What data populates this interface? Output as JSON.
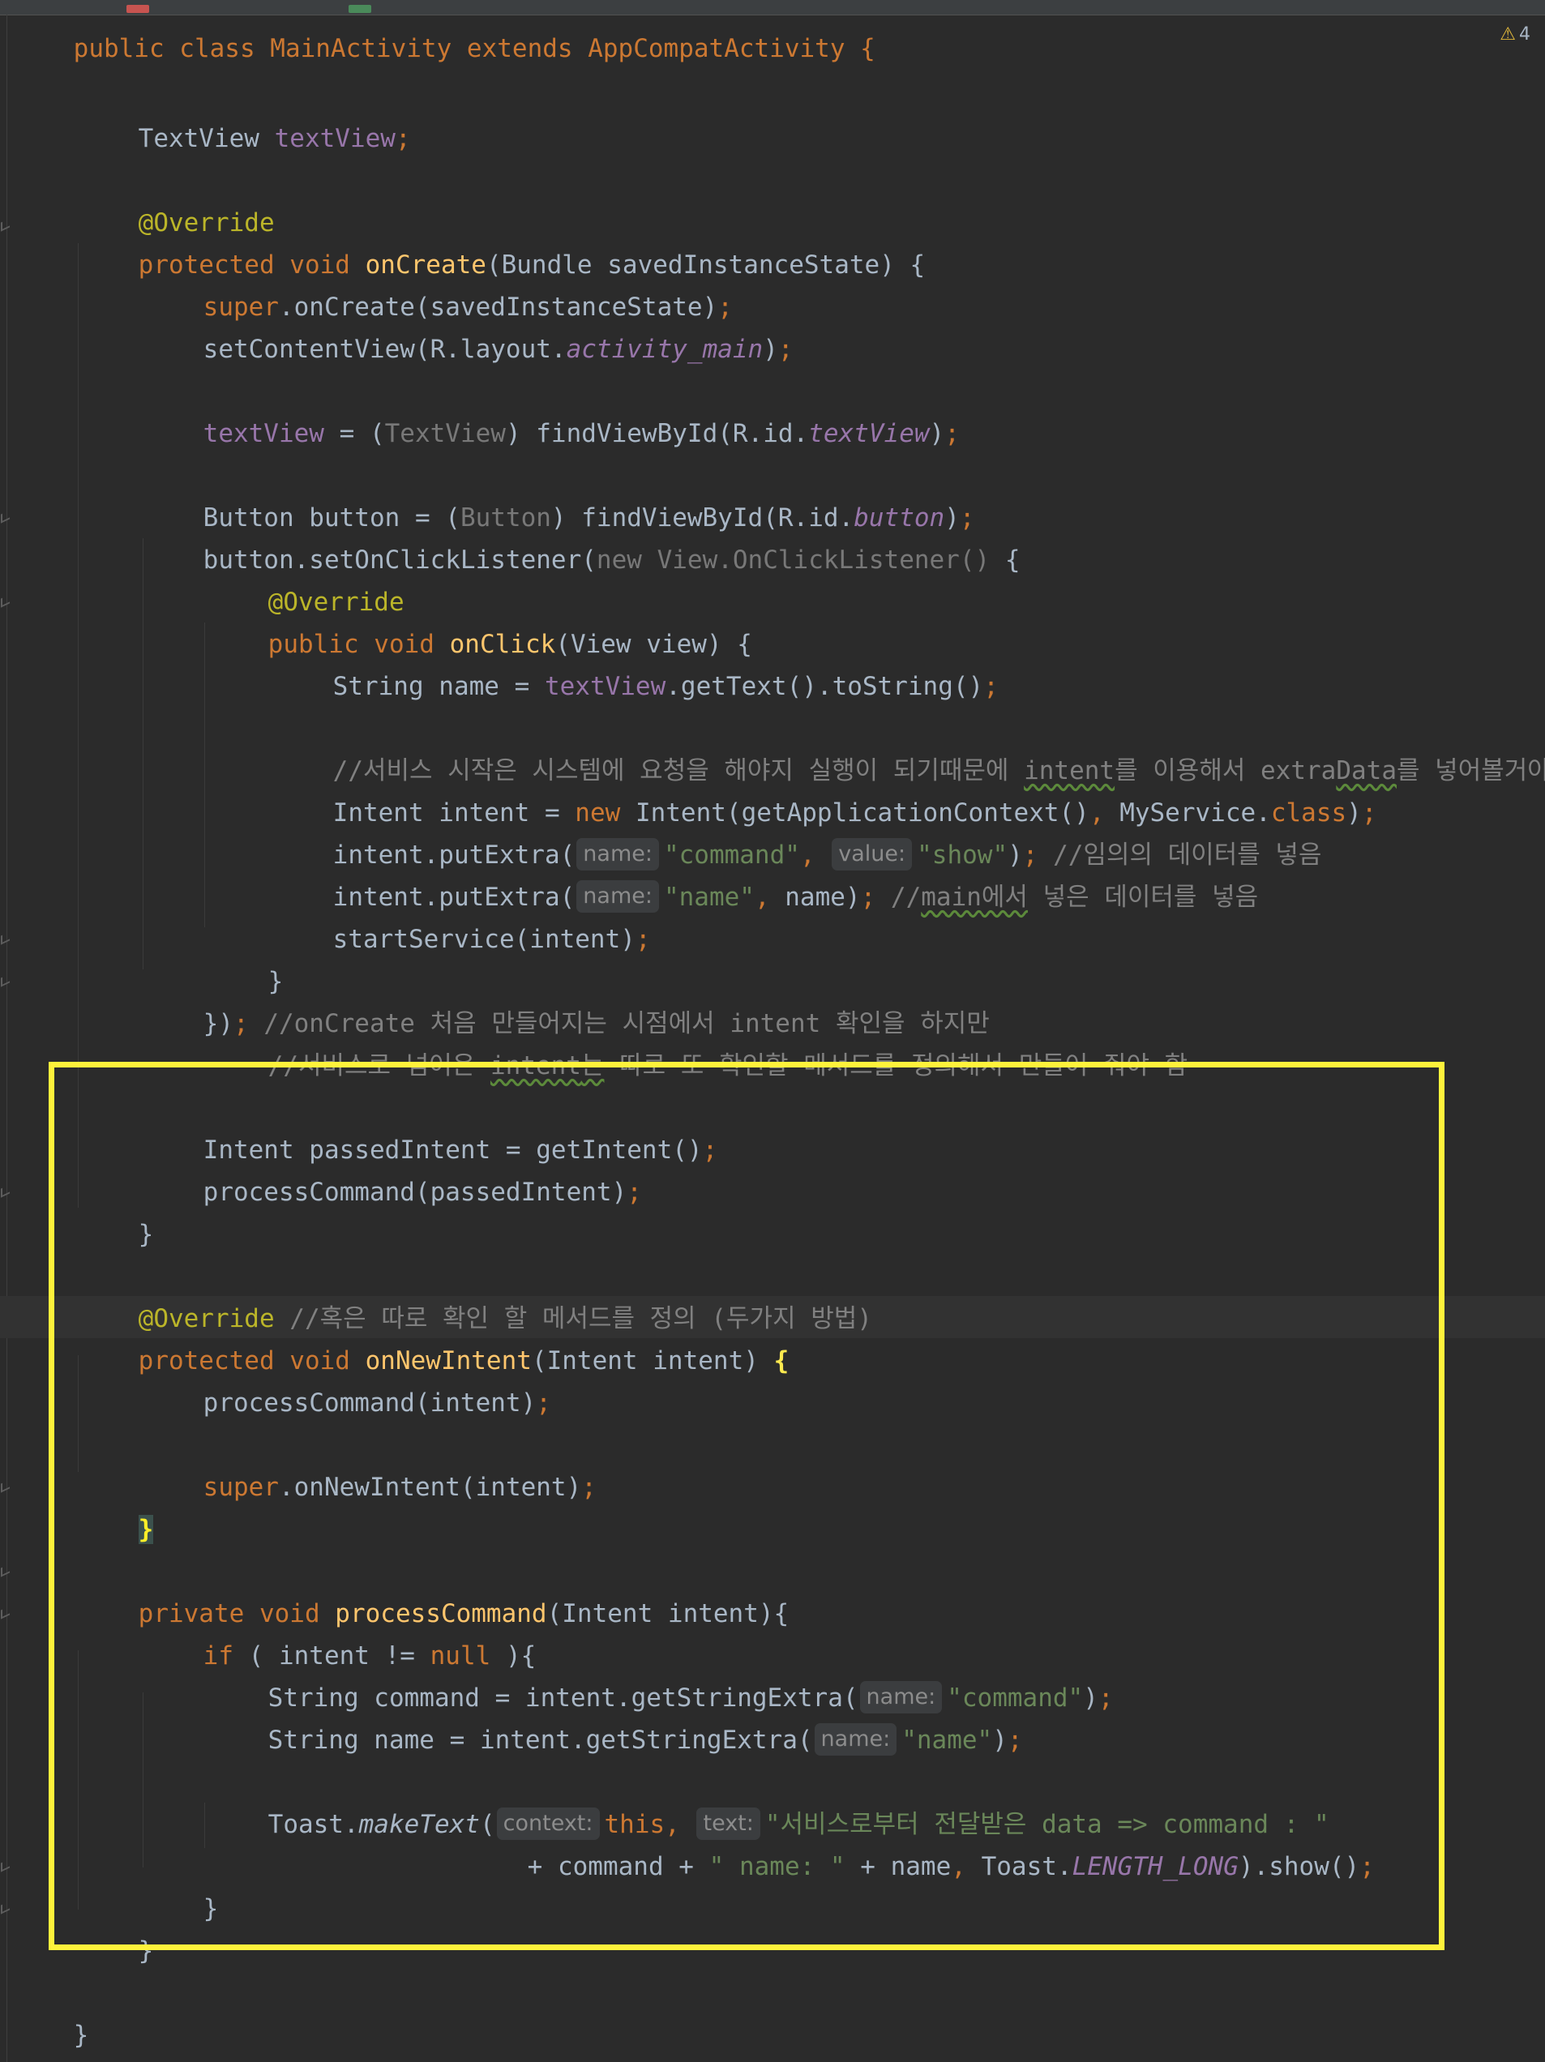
{
  "editor": {
    "warning_count": "4",
    "colors": {
      "background": "#2b2b2b",
      "keyword": "#cc7832",
      "method": "#ffc66d",
      "annotation": "#bbb529",
      "field": "#9876aa",
      "string": "#6a8759",
      "comment": "#808080",
      "highlight_box": "#fff23b"
    }
  },
  "code": {
    "l0": [
      "public class MainActivity extends AppCompatActivity {"
    ],
    "l2": [
      "TextView ",
      "textView",
      ";"
    ],
    "l4": [
      "@Override"
    ],
    "l5": [
      "protected void ",
      "onCreate",
      "(Bundle savedInstanceState) {"
    ],
    "l6": [
      "super",
      ".onCreate(savedInstanceState)",
      ";"
    ],
    "l7": [
      "setContentView(R.layout.",
      "activity_main",
      ")",
      ";"
    ],
    "l9": [
      "textView",
      " = (",
      "TextView",
      ") findViewById(R.id.",
      "textView",
      ")",
      ";"
    ],
    "l11": [
      "Button button = (",
      "Button",
      ") findViewById(R.id.",
      "button",
      ")",
      ";"
    ],
    "l12": [
      "button.setOnClickListener(",
      "new View.OnClickListener()",
      " {"
    ],
    "l13": [
      "@Override"
    ],
    "l14": [
      "public void ",
      "onClick",
      "(View view) {"
    ],
    "l15": [
      "String name = ",
      "textView",
      ".getText().toString()",
      ";"
    ],
    "l17": [
      "//서비스 시작은 시스템에 요청을 해야지 실행이 되기때문에 ",
      "intent",
      "를 이용해서 extra",
      "Data",
      "를 넣어볼거야"
    ],
    "l18": [
      "Intent intent = ",
      "new ",
      "Intent(getApplicationContext()",
      ", ",
      "MyService.",
      "class",
      ")",
      ";"
    ],
    "l19": [
      "intent.putExtra(",
      "name:",
      "\"command\"",
      ", ",
      "value:",
      "\"show\"",
      ")",
      "; ",
      "//임의의 데이터를 넣음"
    ],
    "l20": [
      "intent.putExtra(",
      "name:",
      "\"name\"",
      ", ",
      "name)",
      "; ",
      "//",
      "main",
      "에서",
      " 넣은 데이터를 넣음"
    ],
    "l21": [
      "startService(intent)",
      ";"
    ],
    "l22": [
      "}"
    ],
    "l23": [
      "})",
      "; ",
      "//onCreate 처음 만들어지는 시점에서 intent 확인을 하지만"
    ],
    "l24": [
      "//서비스로 넘어온 ",
      "intent",
      "는",
      " 따로 또 확인할 메서드를 정의해서 만들어 줘야 함"
    ],
    "l26": [
      "Intent passedIntent = getIntent()",
      ";"
    ],
    "l27": [
      "processCommand(passedIntent)",
      ";"
    ],
    "l28": [
      "}"
    ],
    "l30": [
      "@Override ",
      "//혹은 따로 확인 할 메서드를 정의 (두가지 방법)"
    ],
    "l31": [
      "protected void ",
      "onNewIntent",
      "(Intent intent) ",
      "{"
    ],
    "l32": [
      "processCommand(intent)",
      ";"
    ],
    "l34": [
      "super",
      ".onNewIntent(intent)",
      ";"
    ],
    "l35": [
      "}"
    ],
    "l37": [
      "private void ",
      "processCommand",
      "(Intent intent){"
    ],
    "l38": [
      "if ",
      "( intent != ",
      "null ",
      "){"
    ],
    "l39": [
      "String command = intent.getStringExtra(",
      "name:",
      "\"command\"",
      ")",
      ";"
    ],
    "l40": [
      "String name = intent.getStringExtra(",
      "name:",
      "\"name\"",
      ")",
      ";"
    ],
    "l42": [
      "Toast.",
      "makeText",
      "(",
      "context:",
      "this",
      ", ",
      "text:",
      "\"서비스로부터 전달받은 data => command : \""
    ],
    "l43": [
      "+ command + ",
      "\" name: \"",
      " + name",
      ", ",
      "Toast.",
      "LENGTH_LONG",
      ").show()",
      ";"
    ],
    "l44": [
      "}"
    ],
    "l45": [
      "}"
    ],
    "l47": [
      "}"
    ]
  }
}
